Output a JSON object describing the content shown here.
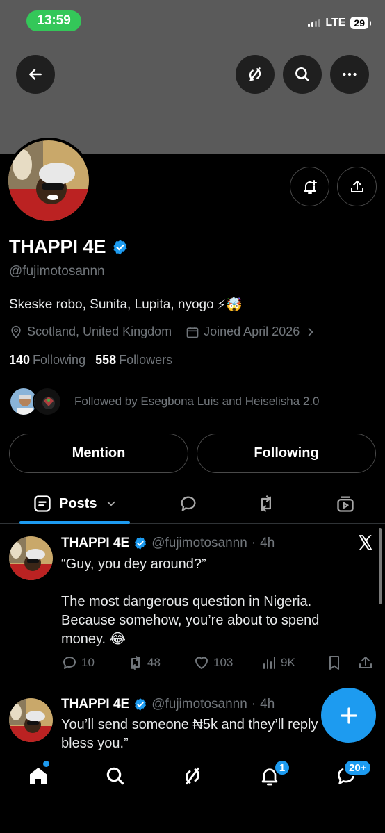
{
  "status_bar": {
    "time": "13:59",
    "network": "LTE",
    "battery": "29"
  },
  "profile": {
    "name": "THAPPI 4E",
    "handle": "@fujimotosannn",
    "bio": "Skeske robo, Sunita, Lupita, nyogo",
    "bio_emoji": "⚡🤯",
    "location": "Scotland, United Kingdom",
    "joined": "Joined April 2026",
    "following_count": "140",
    "following_label": "Following",
    "followers_count": "558",
    "followers_label": "Followers",
    "followed_by": "Followed by Esegbona Luis and Heiselisha 2.0"
  },
  "buttons": {
    "mention": "Mention",
    "following": "Following"
  },
  "tabs": {
    "posts": "Posts"
  },
  "posts": [
    {
      "name": "THAPPI 4E",
      "handle": "@fujimotosannn",
      "dot": "·",
      "time": "4h",
      "text_line1": "“Guy, you dey around?”",
      "text_line2": "The most dangerous question in Nigeria. Because somehow, you’re about to spend money. 😂",
      "replies": "10",
      "reposts": "48",
      "likes": "103",
      "views": "9K"
    },
    {
      "name": "THAPPI 4E",
      "handle": "@fujimotosannn",
      "dot": "·",
      "time": "4h",
      "text": "You’ll send someone ₦5k and they’ll reply “God bless you.”"
    }
  ],
  "nav": {
    "notifications_badge": "1",
    "messages_badge": "20+"
  },
  "colors": {
    "accent": "#1d9bf0",
    "status_green": "#34c759",
    "banner": "#5a5a5a"
  }
}
